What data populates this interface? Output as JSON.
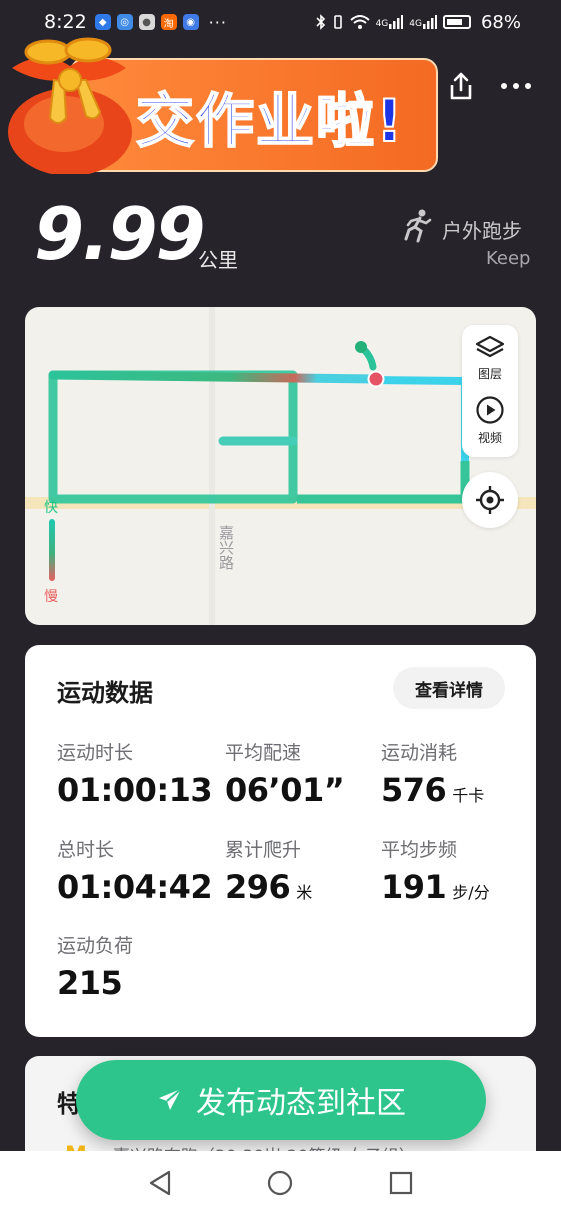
{
  "status": {
    "time": "8:22",
    "apps": [
      {
        "icon": "shield-app-icon",
        "color": "#2f7ae8",
        "glyph": "◆"
      },
      {
        "icon": "globe-app-icon",
        "color": "#3f8be6",
        "glyph": "◎"
      },
      {
        "icon": "chat-app-icon",
        "color": "#d8d8d8",
        "glyph": "●"
      },
      {
        "icon": "taobao-app-icon",
        "color": "#ff6a00",
        "glyph": "淘"
      },
      {
        "icon": "bulb-app-icon",
        "color": "#3f7ae6",
        "glyph": "◉"
      }
    ],
    "more": "···",
    "signal1": "4G",
    "signal2": "4G",
    "battery": "68%"
  },
  "banner": {
    "title": "交作业啦!"
  },
  "summary": {
    "distance": "9.99",
    "distance_unit": "公里",
    "sport_type": "户外跑步",
    "source": "Keep"
  },
  "map": {
    "road_name": "嘉兴路",
    "layers_label": "图层",
    "video_label": "视频",
    "legend_fast": "快",
    "legend_slow": "慢"
  },
  "stats": {
    "title": "运动数据",
    "details_button": "查看详情",
    "items": [
      {
        "label": "运动时长",
        "value": "01:00:13",
        "unit": ""
      },
      {
        "label": "平均配速",
        "value": "06’01”",
        "unit": ""
      },
      {
        "label": "运动消耗",
        "value": "576",
        "unit": "千卡"
      },
      {
        "label": "总时长",
        "value": "01:04:42",
        "unit": ""
      },
      {
        "label": "累计爬升",
        "value": "296",
        "unit": "米"
      },
      {
        "label": "平均步频",
        "value": "191",
        "unit": "步/分"
      },
      {
        "label": "运动负荷",
        "value": "215",
        "unit": ""
      }
    ]
  },
  "next_card": {
    "title": "特",
    "row_text": "嘉兴路奔跑（30-39岁 20等级 女子组）>"
  },
  "publish": {
    "label": "发布动态到社区"
  },
  "colors": {
    "accent": "#2dc58c",
    "background": "#26232a",
    "track_fast": "#1fc9b0",
    "track_slow": "#e86060"
  }
}
